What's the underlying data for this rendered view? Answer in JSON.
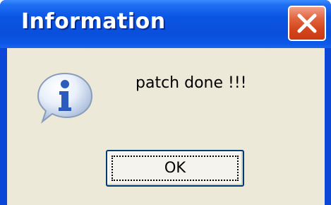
{
  "window": {
    "title": "Information",
    "message": "patch done !!!",
    "icon": "information-icon"
  },
  "buttons": {
    "close_icon": "close-icon",
    "ok_label": "OK"
  },
  "colors": {
    "titlebar": "#0a4fdc",
    "client_background": "#ece9d8",
    "close_button": "#d3451c",
    "info_icon_blue": "#2a5bbd"
  }
}
